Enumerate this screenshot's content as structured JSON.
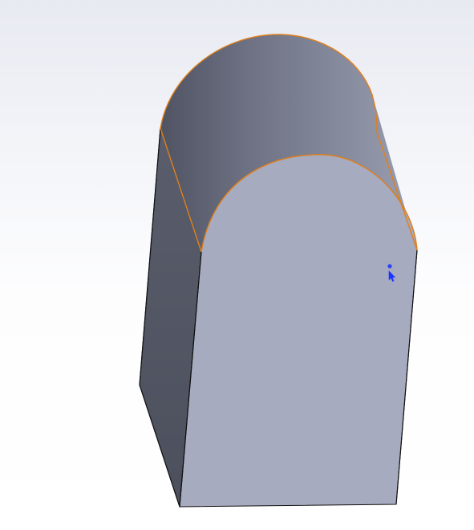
{
  "app": {
    "viewport_label": ""
  },
  "model": {
    "shape": "extruded-arch-block",
    "colors": {
      "front_face": "#a7abbf",
      "left_face": "#575b69",
      "top_curved_face_light": "#8a8fa2",
      "top_curved_face_dark": "#5b5f6e",
      "selected_edge": "#e0801a",
      "edge": "#111111"
    },
    "selection": {
      "selected_face": "cylindrical-top-face",
      "state": "selected"
    }
  },
  "cursor": {
    "icon": "pointer-cursor-with-selection-marker",
    "color": "#1a33ff"
  }
}
